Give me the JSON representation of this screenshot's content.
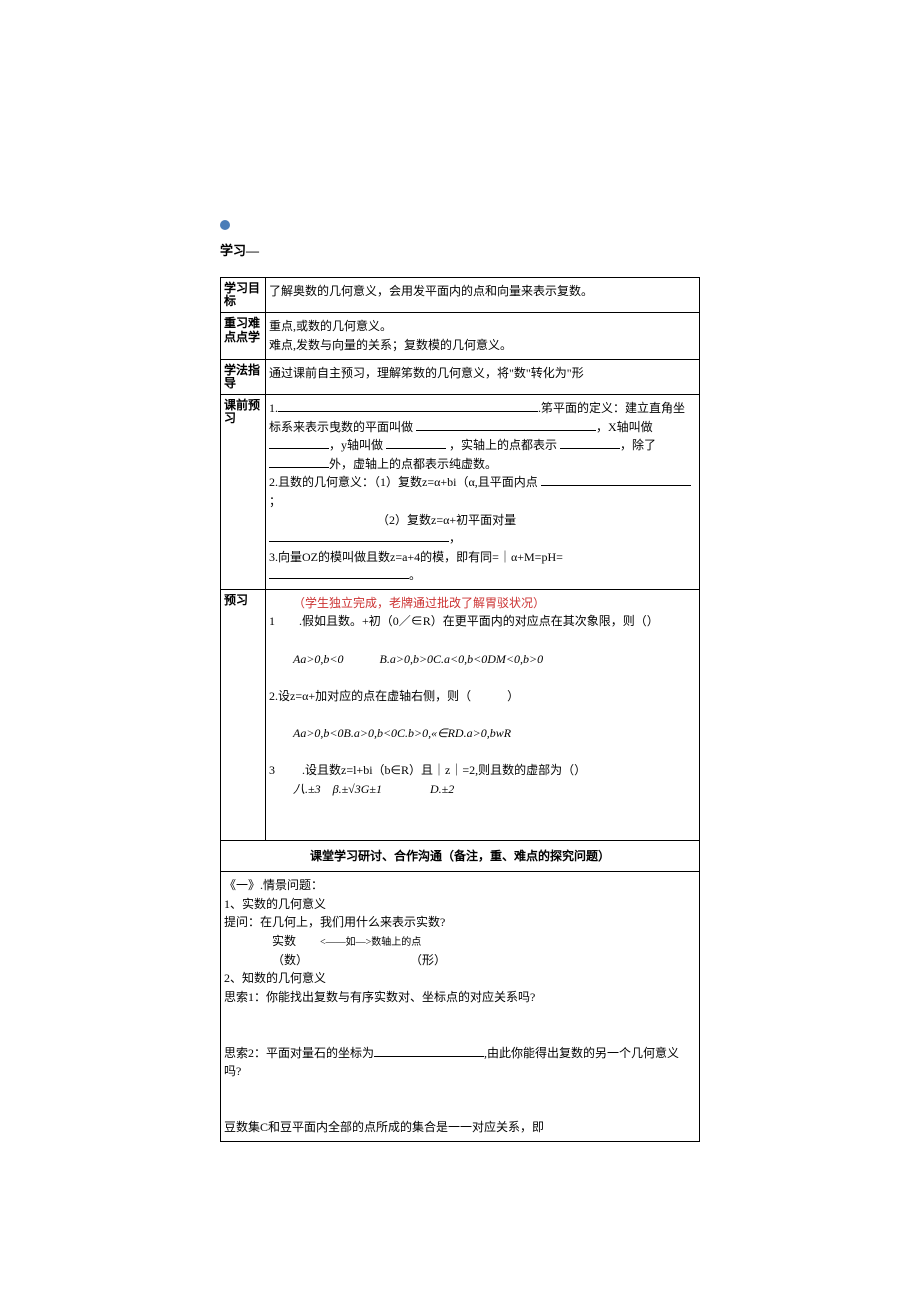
{
  "header": {
    "title": "学习—"
  },
  "t": {
    "r1h": "学习目标",
    "r1c": "了解奥数的几何意义，会用发平面内的点和向量来表示复数。",
    "r2h": "重习难点点学",
    "r2l1": "重点,或数的几何意义。",
    "r2l2": "难点,发数与向量的关系；复数模的几何意义。",
    "r3h": "学法指导",
    "r3c": "通过课前自主预习，理解笫数的几何意义，将\"数\"转化为\"形",
    "r4h": "课前预习",
    "r4p1a": "1.",
    "r4p1b": "笫平面的定义：建立直角坐标系来表示曳数的平面叫做",
    "r4p1c": "，X轴叫做",
    "r4p1d": "，y轴叫做",
    "r4p1e": " ，实轴上的点都表示",
    "r4p1f": "，除了",
    "r4p1g": "外，虚轴上的点都表示纯虚数。",
    "r4p2a": "2.且数的几何意义：（1）复数z=α+bi（α,且平面内点",
    "r4p2b": "；",
    "r4p2c": "（2）复数z=α+初平面对量",
    "r4p2d": "，",
    "r4p3a": "3.向量OZ的模叫做且数z=a+4的模，即有同=｜α+M=pH=",
    "r4p3b": "。",
    "r5h": "预习",
    "r5red": "（学生独立完成，老牌通过批改了解胃驳状况）",
    "r5q1": "1　　.假如且数。+初（0／∈R）在更平面内的对应点在其次象限，则（）",
    "r5q1o": "Aa>0,b<0　　　B.a>0,b>0C.a<0,b<0DM<0,b>0",
    "r5q2": "2.设z=α+加对应的点在虚轴右侧，则（　　　）",
    "r5q2o": "Aa>0,b<0B.a>0,b<0C.b>0,«∈RD.a>0,bwR",
    "r5q3": "3　　 .设且数z=l+bi（b∈R）且｜z｜=2,则且数的虚部为（）",
    "r5q3o": "八.±3　β.±√3G±1　　　　D.±2"
  },
  "mid": "课堂学习研讨、合作沟通（备注，重、难点的探究问题）",
  "bot": {
    "p1": "《一》.情景问题：",
    "p2": "1、实数的几何意义",
    "p3": "提问：在几何上，我们用什么来表示实数?",
    "p4a": "实数",
    "p4b": "<——如—>数轴上的点",
    "p5a": "（数）",
    "p5b": "（形）",
    "p6": "2、知数的几何意义",
    "p7": "思索1：你能找出复数与有序实数对、坐标点的对应关系吗?",
    "p8a": "思索2：平面对量石的坐标为",
    "p8b": ",由此你能得出复数的另一个几何意义吗?",
    "p9": "豆数集C和豆平面内全部的点所成的集合是一一对应关系，即"
  }
}
